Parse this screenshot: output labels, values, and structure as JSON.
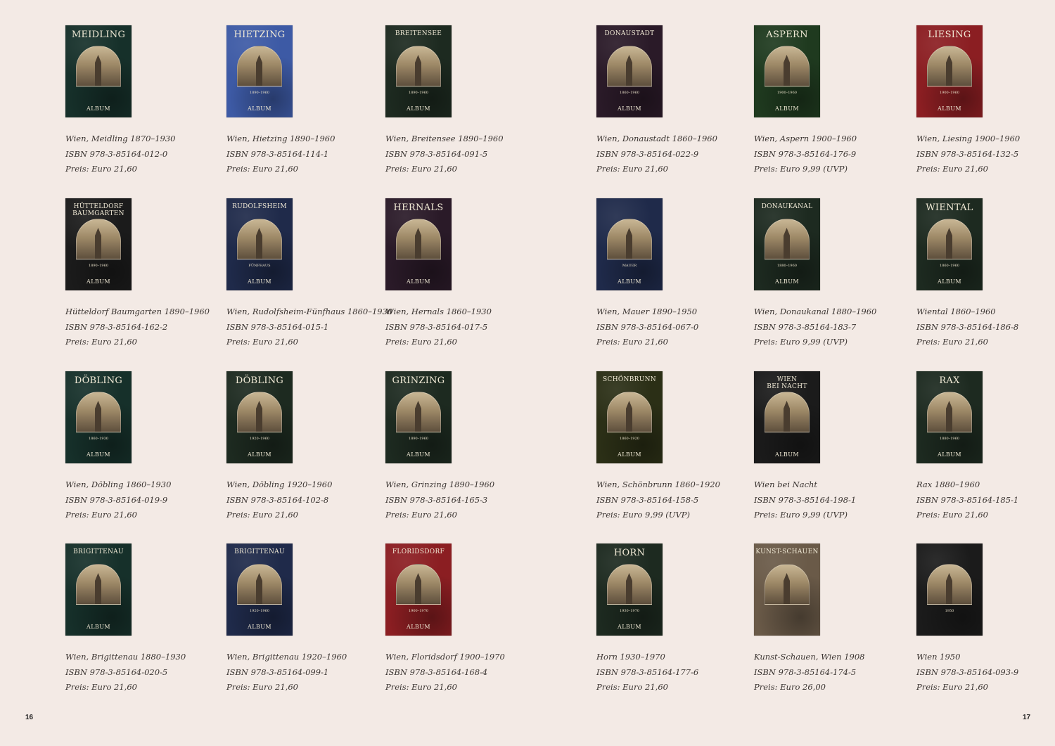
{
  "colors": {
    "background": "#f3eae5",
    "cover_dark_green": "#1d2a20",
    "cover_teal": "#16302a",
    "cover_blue": "#3d5aa5",
    "cover_navy": "#1f2a4a",
    "cover_red_plaid": "#8b1e22",
    "cover_black": "#1b1b1b",
    "cover_olive": "#2b2f16",
    "cover_purple": "#2a1a28"
  },
  "pages": {
    "left": "16",
    "right": "17"
  },
  "books": [
    {
      "cover_title": "MEIDLING",
      "cover_years": "",
      "cover_label": "ALBUM",
      "title": "Wien, Meidling 1870–1930",
      "isbn": "ISBN 978-3-85164-012-0",
      "price": "Preis: Euro 21,60",
      "cover_color": "#16302a"
    },
    {
      "cover_title": "HIETZING",
      "cover_years": "1890–1960",
      "cover_label": "ALBUM",
      "title": "Wien, Hietzing 1890–1960",
      "isbn": "ISBN 978-3-85164-114-1",
      "price": "Preis: Euro 21,60",
      "cover_color": "#3d5aa5"
    },
    {
      "cover_title": "BREITENSEE",
      "cover_years": "1890–1960",
      "cover_label": "ALBUM",
      "title": "Wien, Breitensee 1890–1960",
      "isbn": "ISBN 978-3-85164-091-5",
      "price": "Preis: Euro 21,60",
      "cover_color": "#1d2a20"
    },
    {
      "cover_title": "DONAUSTADT",
      "cover_years": "1860–1960",
      "cover_label": "ALBUM",
      "title": "Wien, Donaustadt 1860–1960",
      "isbn": "ISBN 978-3-85164-022-9",
      "price": "Preis: Euro 21,60",
      "cover_color": "#2a1a28"
    },
    {
      "cover_title": "ASPERN",
      "cover_years": "1900–1960",
      "cover_label": "ALBUM",
      "title": "Wien, Aspern 1900–1960",
      "isbn": "ISBN 978-3-85164-176-9",
      "price": "Preis: Euro 9,99 (UVP)",
      "cover_color": "#1f3a1f"
    },
    {
      "cover_title": "LIESING",
      "cover_years": "1900–1960",
      "cover_label": "ALBUM",
      "title": "Wien, Liesing 1900–1960",
      "isbn": "ISBN 978-3-85164-132-5",
      "price": "Preis: Euro 21,60",
      "cover_color": "#8b1e22"
    },
    {
      "cover_title": "HÜTTELDORF\nBAUMGARTEN",
      "cover_years": "1890–1960",
      "cover_label": "ALBUM",
      "title": "Hütteldorf Baumgarten 1890–1960",
      "isbn": "ISBN 978-3-85164-162-2",
      "price": "Preis: Euro 21,60",
      "cover_color": "#1b1b1b"
    },
    {
      "cover_title": "RUDOLFSHEIM",
      "cover_years": "FÜNFHAUS",
      "cover_label": "ALBUM",
      "title": "Wien, Rudolfsheim-Fünfhaus 1860–1930",
      "isbn": "ISBN 978-3-85164-015-1",
      "price": "Preis: Euro 21,60",
      "cover_color": "#1f2a4a"
    },
    {
      "cover_title": "HERNALS",
      "cover_years": "",
      "cover_label": "ALBUM",
      "title": "Wien, Hernals 1860–1930",
      "isbn": "ISBN 978-3-85164-017-5",
      "price": "Preis: Euro 21,60",
      "cover_color": "#2a1a28"
    },
    {
      "cover_title": "",
      "cover_years": "MAUER",
      "cover_label": "ALBUM",
      "title": "Wien, Mauer 1890–1950",
      "isbn": "ISBN 978-3-85164-067-0",
      "price": "Preis: Euro 21,60",
      "cover_color": "#1f2a4a"
    },
    {
      "cover_title": "DONAUKANAL",
      "cover_years": "1880–1960",
      "cover_label": "ALBUM",
      "title": "Wien, Donaukanal 1880–1960",
      "isbn": "ISBN 978-3-85164-183-7",
      "price": "Preis: Euro 9,99 (UVP)",
      "cover_color": "#1d2a20"
    },
    {
      "cover_title": "WIENTAL",
      "cover_years": "1860–1960",
      "cover_label": "ALBUM",
      "title": "Wiental 1860–1960",
      "isbn": "ISBN 978-3-85164-186-8",
      "price": "Preis: Euro 21,60",
      "cover_color": "#1d2a20"
    },
    {
      "cover_title": "DÖBLING",
      "cover_years": "1860–1930",
      "cover_label": "ALBUM",
      "title": "Wien, Döbling 1860–1930",
      "isbn": "ISBN 978-3-85164-019-9",
      "price": "Preis: Euro 21,60",
      "cover_color": "#16302a"
    },
    {
      "cover_title": "DÖBLING",
      "cover_years": "1920–1960",
      "cover_label": "ALBUM",
      "title": "Wien, Döbling 1920–1960",
      "isbn": "ISBN 978-3-85164-102-8",
      "price": "Preis: Euro 21,60",
      "cover_color": "#1d2a20"
    },
    {
      "cover_title": "GRINZING",
      "cover_years": "1890–1960",
      "cover_label": "ALBUM",
      "title": "Wien, Grinzing 1890–1960",
      "isbn": "ISBN 978-3-85164-165-3",
      "price": "Preis: Euro 21,60",
      "cover_color": "#1d2a20"
    },
    {
      "cover_title": "SCHÖNBRUNN",
      "cover_years": "1860–1920",
      "cover_label": "ALBUM",
      "title": "Wien, Schönbrunn 1860–1920",
      "isbn": "ISBN 978-3-85164-158-5",
      "price": "Preis: Euro 9,99 (UVP)",
      "cover_color": "#2b2f16"
    },
    {
      "cover_title": "WIEN\nBEI NACHT",
      "cover_years": "",
      "cover_label": "ALBUM",
      "title": "Wien bei Nacht",
      "isbn": "ISBN 978-3-85164-198-1",
      "price": "Preis: Euro 9,99 (UVP)",
      "cover_color": "#1b1b1b"
    },
    {
      "cover_title": "RAX",
      "cover_years": "1880–1960",
      "cover_label": "ALBUM",
      "title": "Rax 1880–1960",
      "isbn": "ISBN 978-3-85164-185-1",
      "price": "Preis: Euro 21,60",
      "cover_color": "#1d2a20"
    },
    {
      "cover_title": "BRIGITTENAU",
      "cover_years": "",
      "cover_label": "ALBUM",
      "title": "Wien, Brigittenau 1880–1930",
      "isbn": "ISBN 978-3-85164-020-5",
      "price": "Preis: Euro 21,60",
      "cover_color": "#16302a"
    },
    {
      "cover_title": "BRIGITTENAU",
      "cover_years": "1920–1960",
      "cover_label": "ALBUM",
      "title": "Wien, Brigittenau 1920–1960",
      "isbn": "ISBN 978-3-85164-099-1",
      "price": "Preis: Euro 21,60",
      "cover_color": "#1f2a4a"
    },
    {
      "cover_title": "FLORIDSDORF",
      "cover_years": "1900–1970",
      "cover_label": "ALBUM",
      "title": "Wien, Floridsdorf 1900–1970",
      "isbn": "ISBN 978-3-85164-168-4",
      "price": "Preis: Euro 21,60",
      "cover_color": "#8b1e22"
    },
    {
      "cover_title": "HORN",
      "cover_years": "1930–1970",
      "cover_label": "ALBUM",
      "title": "Horn 1930–1970",
      "isbn": "ISBN 978-3-85164-177-6",
      "price": "Preis: Euro 21,60",
      "cover_color": "#1d2a20"
    },
    {
      "cover_title": "KUNST-SCHAUEN",
      "cover_years": "",
      "cover_label": "",
      "title": "Kunst-Schauen, Wien 1908",
      "isbn": "ISBN 978-3-85164-174-5",
      "price": "Preis: Euro 26,00",
      "cover_color": "#6a5a48"
    },
    {
      "cover_title": "",
      "cover_years": "1950",
      "cover_label": "",
      "title": "Wien 1950",
      "isbn": "ISBN 978-3-85164-093-9",
      "price": "Preis: Euro 21,60",
      "cover_color": "#1b1b1b"
    }
  ]
}
